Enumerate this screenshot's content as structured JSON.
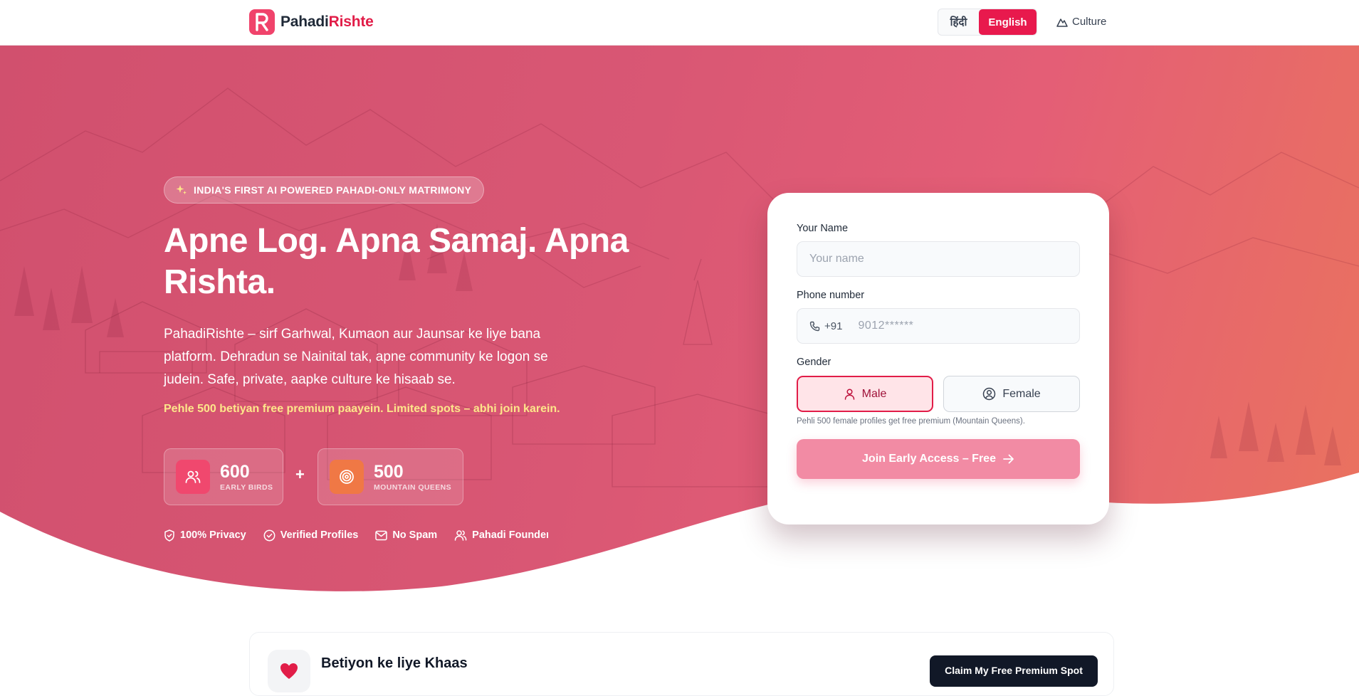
{
  "header": {
    "brand_primary": "Pahadi",
    "brand_accent": "Rishte",
    "logo_letter": "R",
    "lang_hindi": "हिंदी",
    "lang_english": "English",
    "nav_culture": "Culture"
  },
  "hero": {
    "badge": "India's First AI Powered Pahadi-Only Matrimony",
    "headline": "Apne Log. Apna Samaj. Apna Rishta.",
    "subtext": "PahadiRishte – sirf Garhwal, Kumaon aur Jaunsar ke liye bana platform. Dehradun se Nainital tak, apne community ke logon se judein. Safe, private, aapke culture ke hisaab se.",
    "highlight": "Pehle 500 betiyan free premium paayein. Limited spots – abhi join karein.",
    "stats": [
      {
        "value": "600",
        "label": "EARLY BIRDS",
        "icon": "users-icon"
      },
      {
        "value": "500",
        "label": "MOUNTAIN QUEENS",
        "icon": "target-icon"
      }
    ],
    "plus": "+",
    "trust": [
      {
        "label": "100% Privacy",
        "icon": "shield-icon"
      },
      {
        "label": "Verified Profiles",
        "icon": "check-circle-icon"
      },
      {
        "label": "No Spam",
        "icon": "mail-icon"
      },
      {
        "label": "Pahadi Founders",
        "icon": "users-icon"
      }
    ]
  },
  "form": {
    "name_label": "Your Name",
    "name_placeholder": "Your name",
    "phone_label": "Phone number",
    "phone_prefix": "+91",
    "phone_placeholder": "9012******",
    "gender_label": "Gender",
    "gender_male": "Male",
    "gender_female": "Female",
    "gender_selected": "Male",
    "hint": "Pehli 500 female profiles get free premium (Mountain Queens).",
    "submit": "Join Early Access – Free"
  },
  "promo": {
    "title": "Betiyon ke liye Khaas",
    "button": "Claim My Free Premium Spot"
  },
  "colors": {
    "accent": "#e11d48",
    "hero_start": "#d1506e",
    "hero_end": "#ea735e",
    "highlight": "#fde68a"
  }
}
